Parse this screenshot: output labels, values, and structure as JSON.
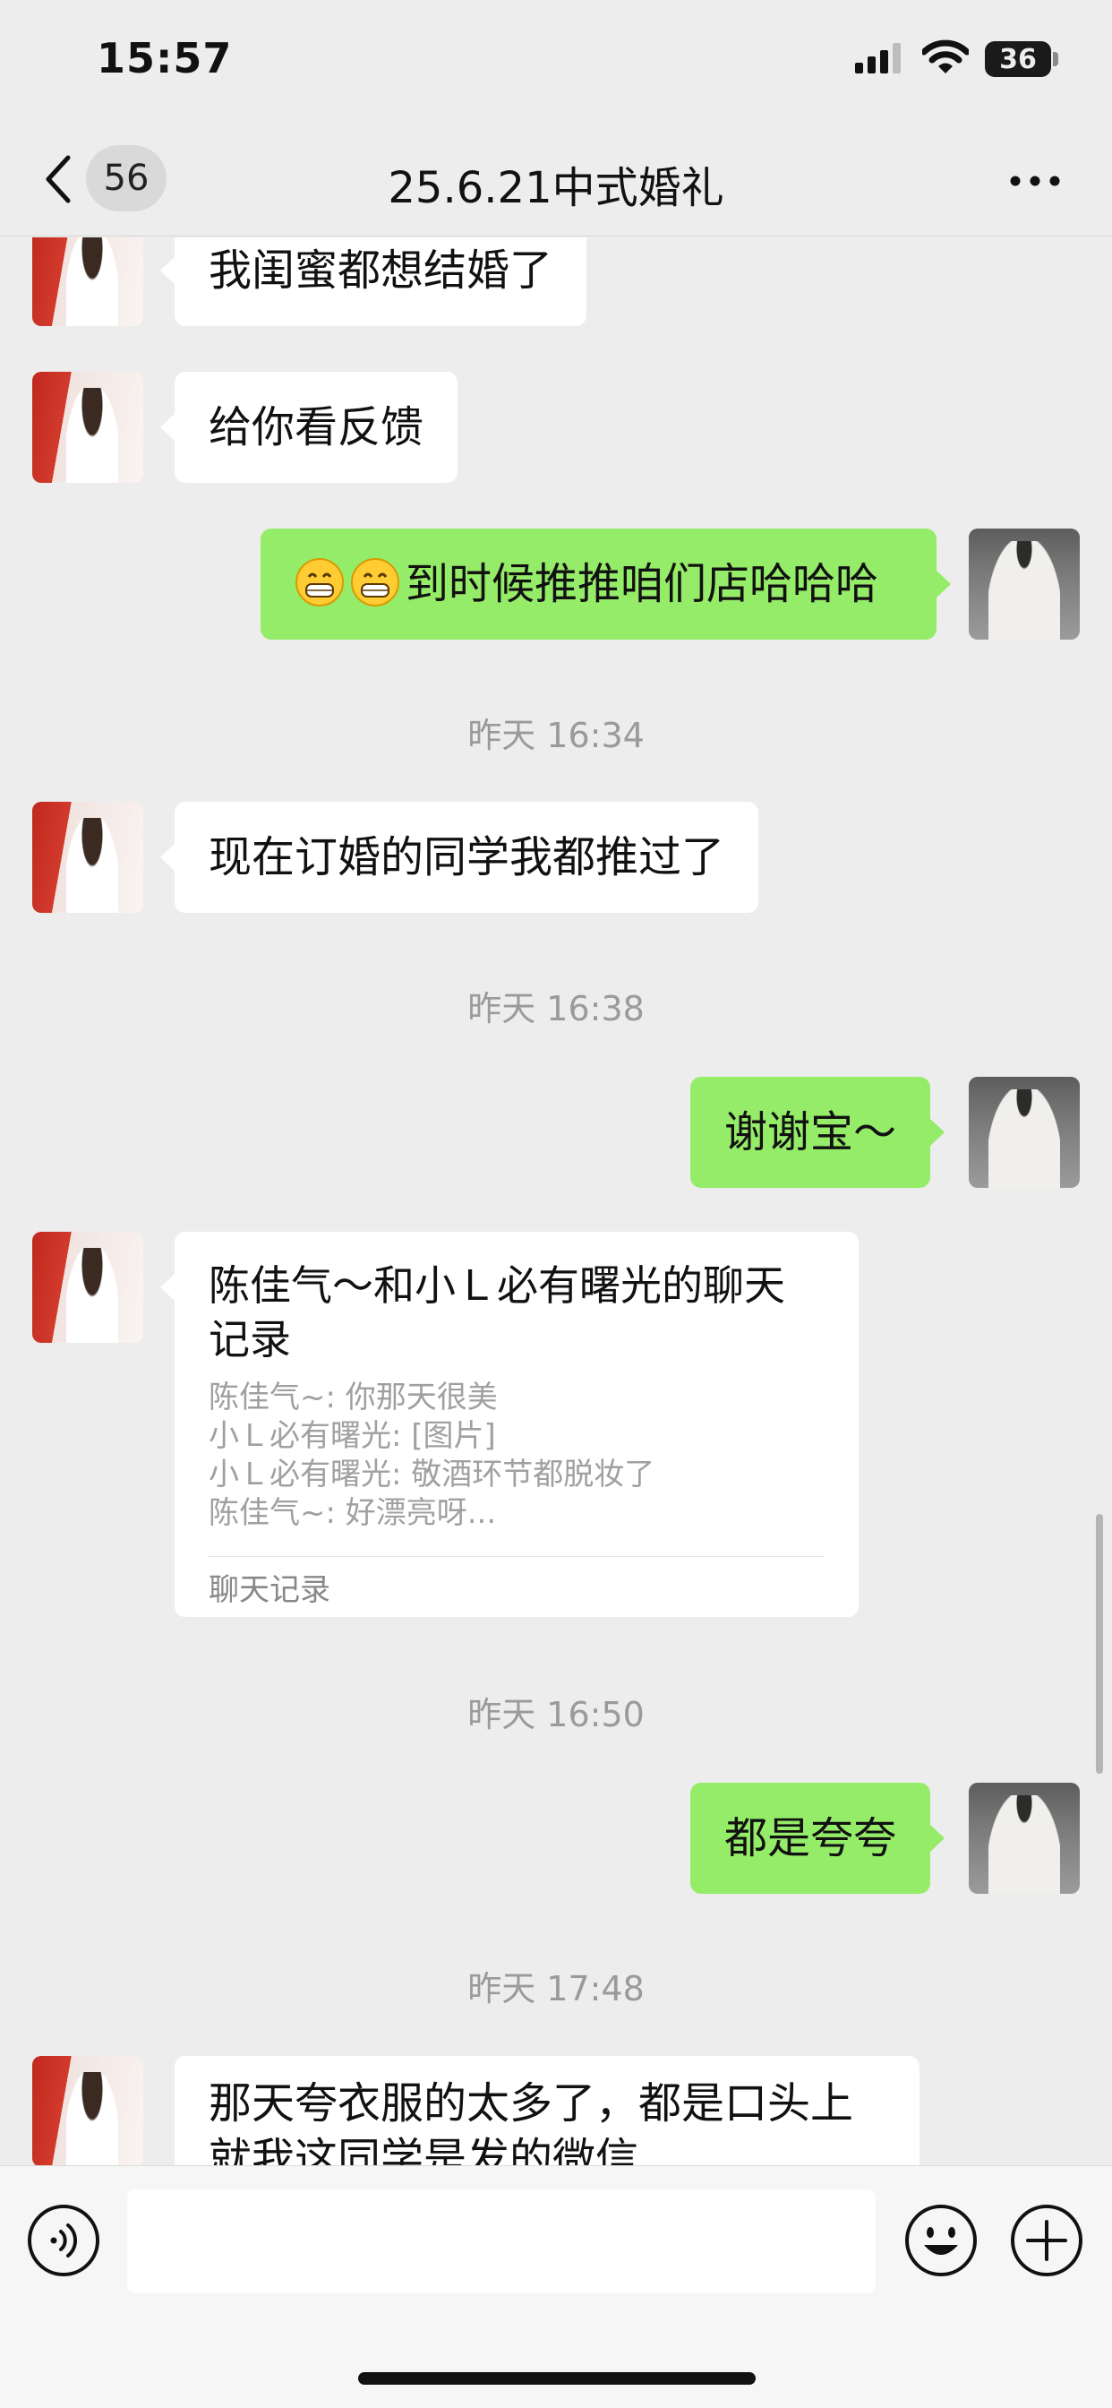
{
  "status_bar": {
    "time": "15:57",
    "battery": "36"
  },
  "nav": {
    "unread_count": "56",
    "title": "25.6.21中式婚礼"
  },
  "messages": [
    {
      "text": "我闺蜜都想结婚了"
    },
    {
      "text": "给你看反馈"
    },
    {
      "text": "到时候推推咱们店哈哈哈",
      "emoji": "grinning-face-emoji"
    },
    {
      "text": "昨天 16:34"
    },
    {
      "text": "现在订婚的同学我都推过了"
    },
    {
      "text": "昨天 16:38"
    },
    {
      "text": "谢谢宝～"
    },
    {
      "title": "陈佳气～和小Ｌ必有曙光的聊天记录",
      "lines": [
        "陈佳气~: 你那天很美",
        "小Ｌ必有曙光: [图片]",
        "小Ｌ必有曙光: 敬酒环节都脱妆了",
        "陈佳气~: 好漂亮呀..."
      ],
      "footer": "聊天记录"
    },
    {
      "text": "昨天 16:50"
    },
    {
      "text": "都是夸夸"
    },
    {
      "text": "昨天 17:48"
    },
    {
      "text": "那天夸衣服的太多了，都是口头上就我这同学是发的微信"
    }
  ],
  "input_bar": {
    "placeholder": ""
  },
  "colors": {
    "background": "#ededed",
    "my_bubble": "#95ec69",
    "their_bubble": "#ffffff"
  }
}
